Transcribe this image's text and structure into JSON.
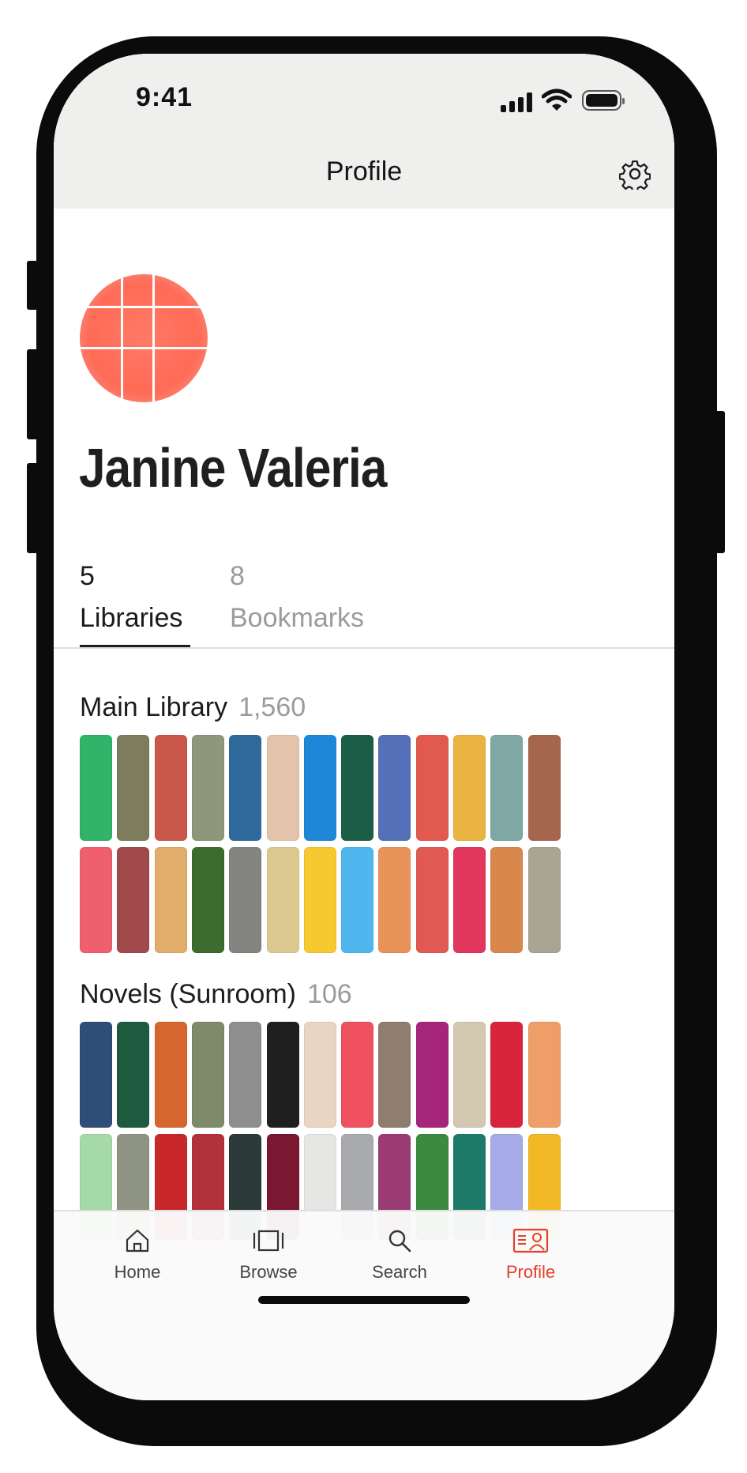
{
  "status": {
    "time": "9:41"
  },
  "nav": {
    "title": "Profile",
    "settings_icon": "gear-icon"
  },
  "profile": {
    "name": "Janine Valeria",
    "avatar_color": "#ff6b57"
  },
  "tabs": [
    {
      "count": "5",
      "label": "Libraries",
      "active": true
    },
    {
      "count": "8",
      "label": "Bookmarks",
      "active": false
    }
  ],
  "libraries": [
    {
      "name": "Main Library",
      "count": "1,560",
      "spine_colors": [
        [
          "#2fb46a",
          "#7d7c5c",
          "#c9584b",
          "#8e977a",
          "#2f6a9c",
          "#e3c4aa",
          "#1e88d8",
          "#1b5e48",
          "#5470b8",
          "#e25a4f",
          "#e9b441",
          "#7fa7a3",
          "#a6664e"
        ],
        [
          "#ef5f6e",
          "#a14a4c",
          "#e0ad6a",
          "#3c6c2e",
          "#848480",
          "#dcc98f",
          "#f7c931",
          "#4fb7ed",
          "#e9935a",
          "#e05a52",
          "#e2365c",
          "#d9874c",
          "#a8a592"
        ]
      ]
    },
    {
      "name": "Novels (Sunroom)",
      "count": "106",
      "spine_colors": [
        [
          "#2e4d78",
          "#1e5a3d",
          "#d5662d",
          "#7f8a6a",
          "#8e8e8e",
          "#1f1f1f",
          "#e8d5c2",
          "#ef5160",
          "#8f7e6d",
          "#a4257a",
          "#d3c8b0",
          "#d8253b",
          "#ef9e67"
        ],
        [
          "#a6d9a8",
          "#8f9383",
          "#c8282a",
          "#b2323c",
          "#2d3a3a",
          "#7b1731",
          "#e6e7e5",
          "#a8aaad",
          "#9b3b73",
          "#3c8a3f",
          "#1e7a68",
          "#a6abe8",
          "#f2b826"
        ]
      ]
    }
  ],
  "tabbar": {
    "items": [
      {
        "label": "Home",
        "icon": "home-icon",
        "active": false
      },
      {
        "label": "Browse",
        "icon": "browse-icon",
        "active": false
      },
      {
        "label": "Search",
        "icon": "search-icon",
        "active": false
      },
      {
        "label": "Profile",
        "icon": "profile-icon",
        "active": true
      }
    ],
    "active_color": "#e2402a"
  }
}
